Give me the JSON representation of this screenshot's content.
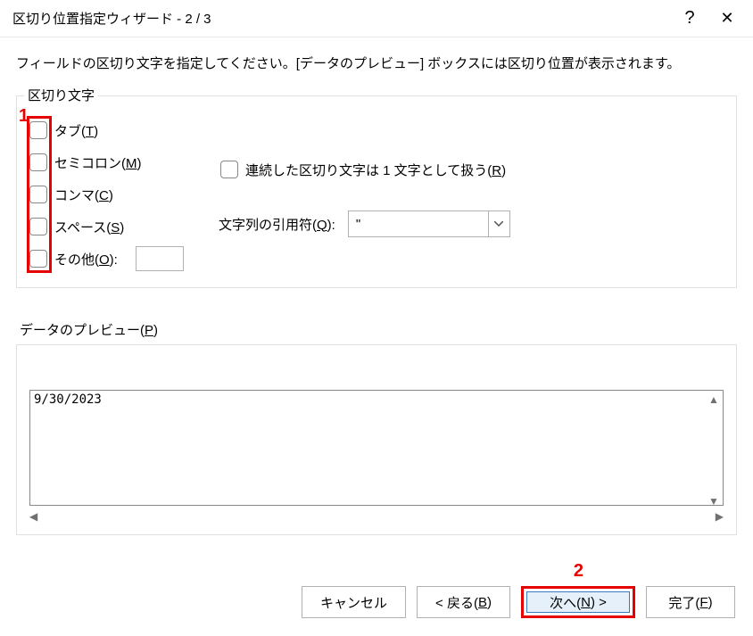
{
  "titlebar": {
    "title": "区切り位置指定ウィザード - 2 / 3",
    "help": "?",
    "close": "✕"
  },
  "instruction": "フィールドの区切り文字を指定してください。[データのプレビュー] ボックスには区切り位置が表示されます。",
  "delimiters": {
    "legend": "区切り文字",
    "tab_label": "タブ(",
    "tab_key": "T",
    "tab_label2": ")",
    "semi_label": "セミコロン(",
    "semi_key": "M",
    "semi_label2": ")",
    "comma_label": "コンマ(",
    "comma_key": "C",
    "comma_label2": ")",
    "space_label": "スペース(",
    "space_key": "S",
    "space_label2": ")",
    "other_label": "その他(",
    "other_key": "O",
    "other_label2": "):",
    "other_value": ""
  },
  "options": {
    "consecutive_label": "連続した区切り文字は 1 文字として扱う(",
    "consecutive_key": "R",
    "consecutive_label2": ")",
    "qualifier_label": "文字列の引用符(",
    "qualifier_key": "Q",
    "qualifier_label2": "):",
    "qualifier_value": "\""
  },
  "preview": {
    "legend": "データのプレビュー(",
    "legend_key": "P",
    "legend2": ")",
    "data_row1": "9/30/2023"
  },
  "buttons": {
    "cancel": "キャンセル",
    "back_pre": "< 戻る(",
    "back_key": "B",
    "back_post": ")",
    "next_pre": "次へ(",
    "next_key": "N",
    "next_post": ") >",
    "finish_pre": "完了(",
    "finish_key": "F",
    "finish_post": ")"
  },
  "callouts": {
    "one": "1",
    "two": "2"
  }
}
